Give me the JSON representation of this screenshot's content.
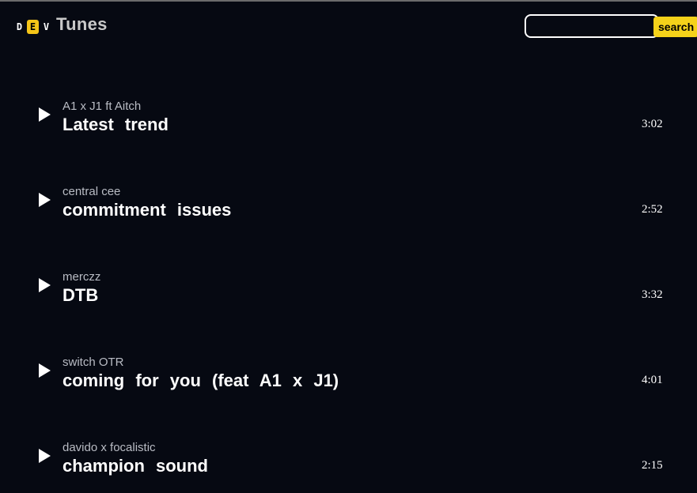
{
  "header": {
    "logo_letters": [
      "D",
      "E",
      "V"
    ],
    "brand": "Tunes",
    "search_placeholder": "",
    "search_value": "",
    "search_button": "search"
  },
  "colors": {
    "background": "#060912",
    "accent": "#f5d21a",
    "text": "#ffffff",
    "muted": "#b9bcc4"
  },
  "tracks": [
    {
      "artist": "A1 x J1 ft Aitch",
      "title": "Latest  trend",
      "duration": "3:02",
      "icon": "play-icon"
    },
    {
      "artist": "central cee",
      "title": "commitment  issues",
      "duration": "2:52",
      "icon": "play-icon"
    },
    {
      "artist": "merczz",
      "title": "DTB",
      "duration": "3:32",
      "icon": "play-icon"
    },
    {
      "artist": "switch OTR",
      "title": "coming  for  you  (feat  A1  x  J1)",
      "duration": "4:01",
      "icon": "play-icon"
    },
    {
      "artist": "davido x focalistic",
      "title": "champion  sound",
      "duration": "2:15",
      "icon": "play-icon"
    }
  ]
}
